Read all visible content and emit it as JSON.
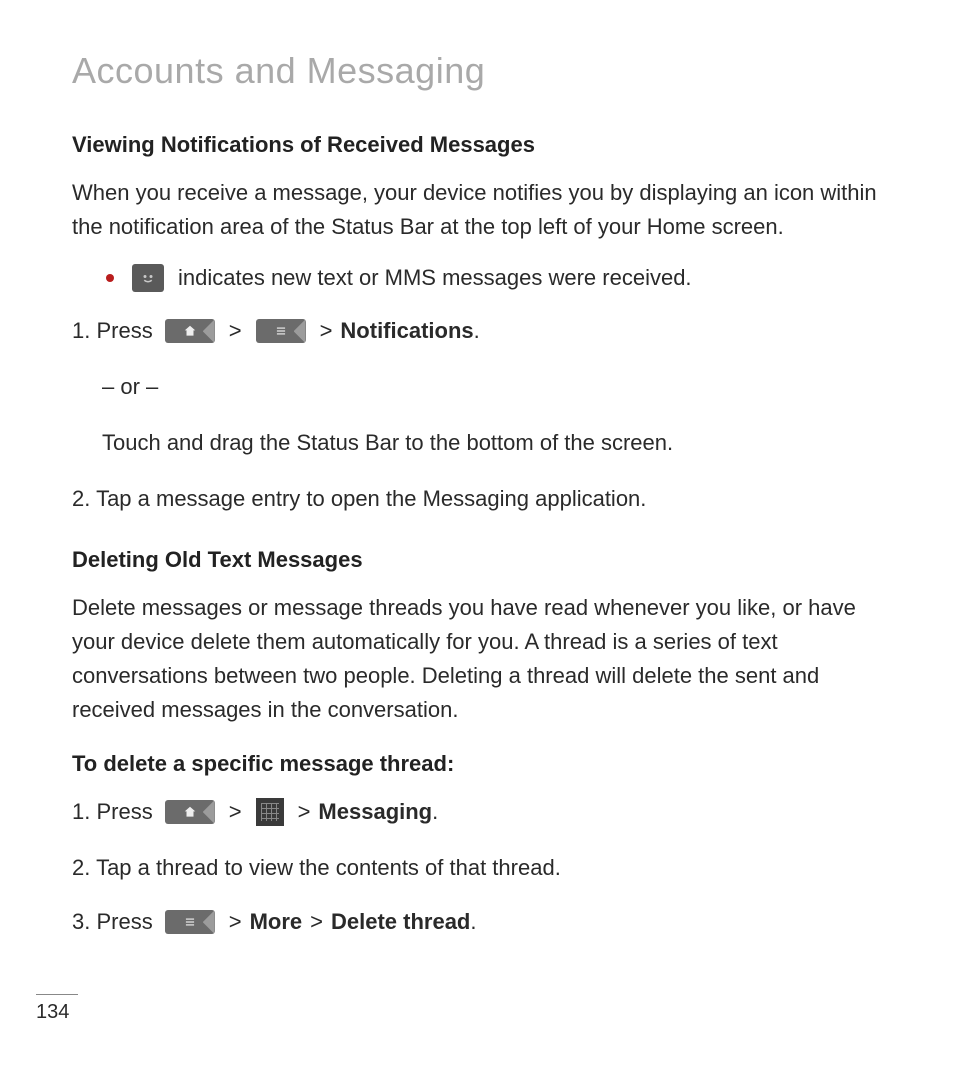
{
  "page_title": "Accounts and Messaging",
  "section1": {
    "heading": "Viewing Notifications of Received Messages",
    "intro": "When you receive a message, your device notifies you by displaying an icon within the notification area of the Status Bar at the top left of your Home screen.",
    "bullet_text": "indicates new text or MMS messages were received.",
    "step1_prefix": "1. Press",
    "step1_gt1": ">",
    "step1_gt2": ">",
    "step1_bold": "Notifications",
    "step1_suffix": ".",
    "or_text": "– or –",
    "or_body": "Touch and drag the Status Bar to the bottom of the screen.",
    "step2": "2. Tap a message entry to open the Messaging application."
  },
  "section2": {
    "heading": "Deleting Old Text Messages",
    "intro": "Delete messages or message threads you have read whenever you like, or have your device delete them automatically for you. A thread is a series of text conversations between two people. Deleting a thread will delete the sent and received messages in the conversation.",
    "subheading": "To delete a specific message thread:",
    "step1_prefix": "1. Press",
    "step1_gt1": ">",
    "step1_gt2": ">",
    "step1_bold": "Messaging",
    "step1_suffix": ".",
    "step2": "2. Tap a thread to view the contents of that thread.",
    "step3_prefix": "3. Press",
    "step3_gt1": ">",
    "step3_bold1": "More",
    "step3_gt2": ">",
    "step3_bold2": "Delete thread",
    "step3_suffix": "."
  },
  "page_number": "134"
}
